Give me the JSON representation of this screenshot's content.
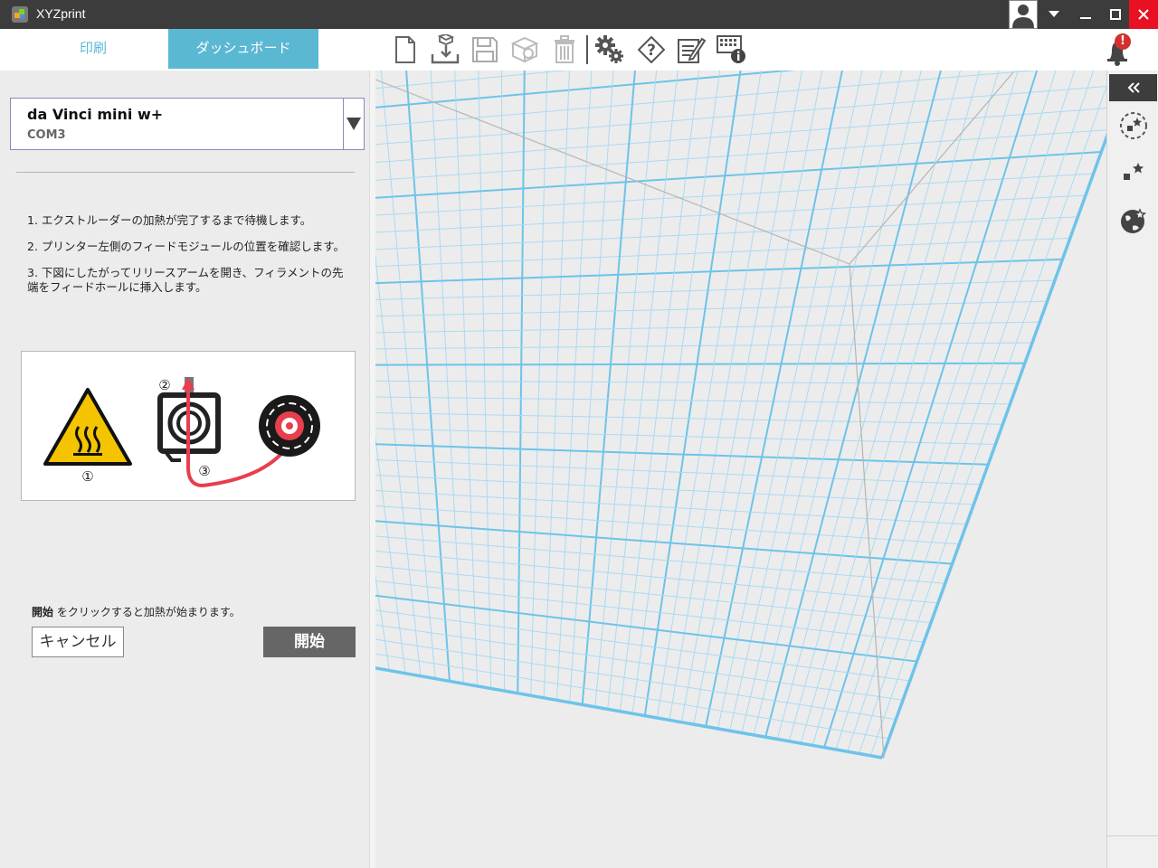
{
  "window": {
    "title": "XYZprint"
  },
  "tabs": [
    {
      "label": "印刷",
      "active": false
    },
    {
      "label": "ダッシュボード",
      "active": true
    }
  ],
  "toolbar_icons": [
    "new-file-icon",
    "import-icon",
    "save-icon",
    "object-icon",
    "trash-icon",
    "settings-icon",
    "help-icon",
    "notes-icon",
    "printer-info-icon"
  ],
  "notification": {
    "badge": "!"
  },
  "printer": {
    "name": "da Vinci mini w+",
    "port": "COM3"
  },
  "steps": [
    "1. エクストルーダーの加熱が完了するまで待機します。",
    "2. プリンター左側のフィードモジュールの位置を確認します。",
    "3. 下図にしたがってリリースアームを開き、フィラメントの先端をフィードホールに挿入します。"
  ],
  "illustration": {
    "label1": "①",
    "label2": "②",
    "label3": "③"
  },
  "hint": {
    "bold": "開始",
    "text": " をクリックすると加熱が始まります。"
  },
  "buttons": {
    "cancel": "キャンセル",
    "start": "開始"
  },
  "colors": {
    "accent": "#5ab8d3",
    "grid_major": "#6ec3ea",
    "grid_minor": "#a9dbf2",
    "close": "#e81123",
    "start_button": "#666666"
  }
}
